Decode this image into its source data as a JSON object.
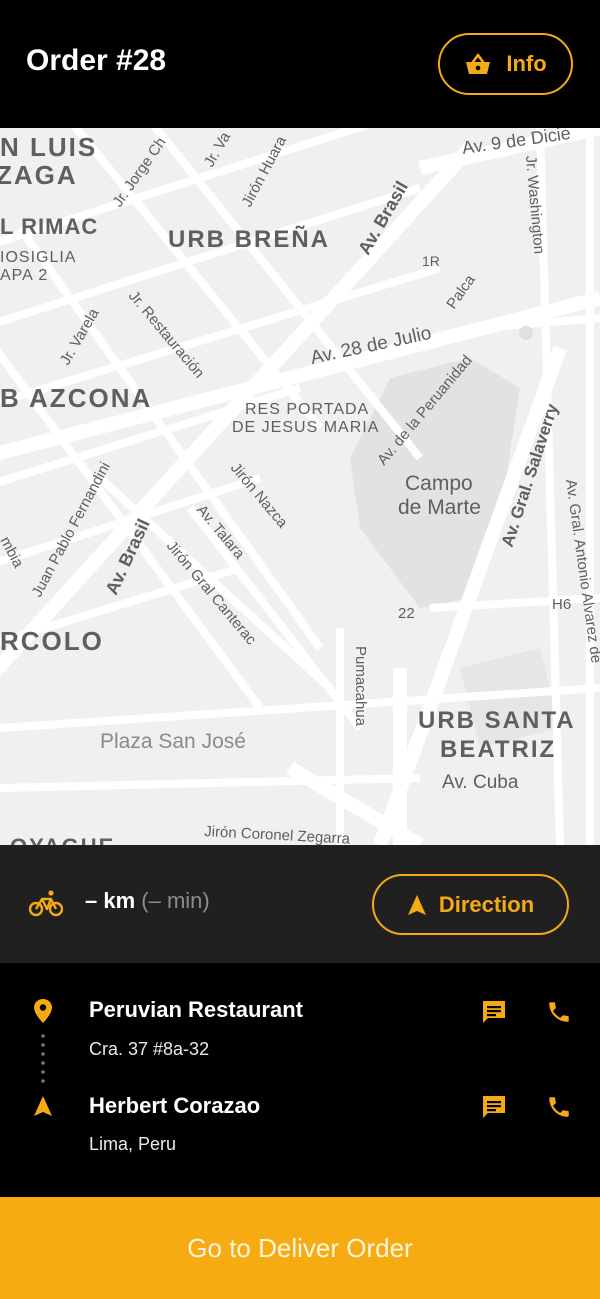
{
  "header": {
    "title": "Order #28",
    "info_label": "Info"
  },
  "map": {
    "labels": [
      "N LUIS",
      "ZAGA",
      "L RIMAC",
      "IOSIGLIA",
      "APA 2",
      "URB BREÑA",
      "B AZCONA",
      "RES PORTADA",
      "DE JESUS MARIA",
      "Campo",
      "de Marte",
      "RCOLO",
      "Plaza San José",
      "URB SANTA",
      "BEATRIZ",
      "Av. Cuba",
      "Av. Brasil",
      "Av. 28 de Julio",
      "Av. 9 de Dicie",
      "Jr. Washington",
      "Palca",
      "1R",
      "Jr. Varela",
      "Jr. Restauración",
      "Jirón Huara",
      "Jr. Jorge Ch",
      "Jr. Va",
      "Av. de la Peruanidad",
      "Av. Gral. Salaverry",
      "Jirón Nazca",
      "Av. Talara",
      "Jirón Gral Canterac",
      "Juan Pablo Fernandini",
      "mbia",
      "Av. Brasil",
      "22",
      "H6",
      "Av. Gral. Antonio Alvarez de",
      "Pumacahua",
      "Jirón Coronel Zegarra",
      "OYAGUE"
    ]
  },
  "distance": {
    "km": "– km",
    "min": "(– min)",
    "direction_label": "Direction"
  },
  "pickup": {
    "name": "Peruvian Restaurant",
    "address": "Cra. 37 #8a-32"
  },
  "dropoff": {
    "name": "Herbert Corazao",
    "address": "Lima, Peru"
  },
  "cta": {
    "label": "Go to Deliver Order"
  },
  "colors": {
    "accent": "#f5a915",
    "panel": "#202020",
    "background": "#000000"
  }
}
